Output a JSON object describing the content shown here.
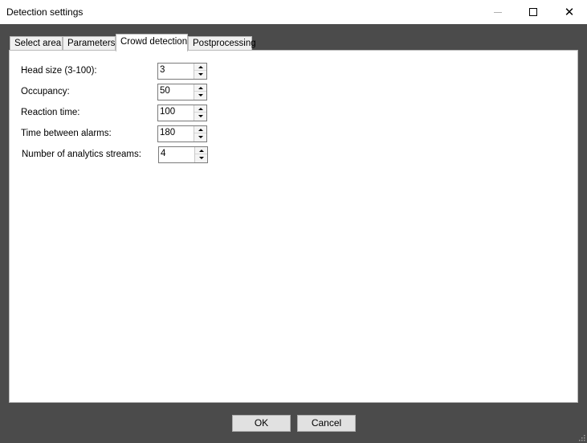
{
  "window": {
    "title": "Detection settings",
    "controls": {
      "minimize_icon": "minimize-icon",
      "maximize_icon": "maximize-icon",
      "close_icon": "close-icon",
      "close_glyph": "✕"
    }
  },
  "tabs": [
    {
      "label": "Select area",
      "active": false
    },
    {
      "label": "Parameters",
      "active": false
    },
    {
      "label": "Crowd detection",
      "active": true
    },
    {
      "label": "Postprocessing",
      "active": false
    }
  ],
  "fields": [
    {
      "label": "Head size (3-100):",
      "value": "3"
    },
    {
      "label": "Occupancy:",
      "value": "50"
    },
    {
      "label": "Reaction time:",
      "value": "100"
    },
    {
      "label": "Time between alarms:",
      "value": "180"
    },
    {
      "label": "Number of analytics streams:",
      "value": "4"
    }
  ],
  "buttons": {
    "ok": "OK",
    "cancel": "Cancel"
  },
  "colors": {
    "dialog_background": "#4b4b4b",
    "panel_background": "#ffffff",
    "button_face": "#e1e1e1"
  }
}
